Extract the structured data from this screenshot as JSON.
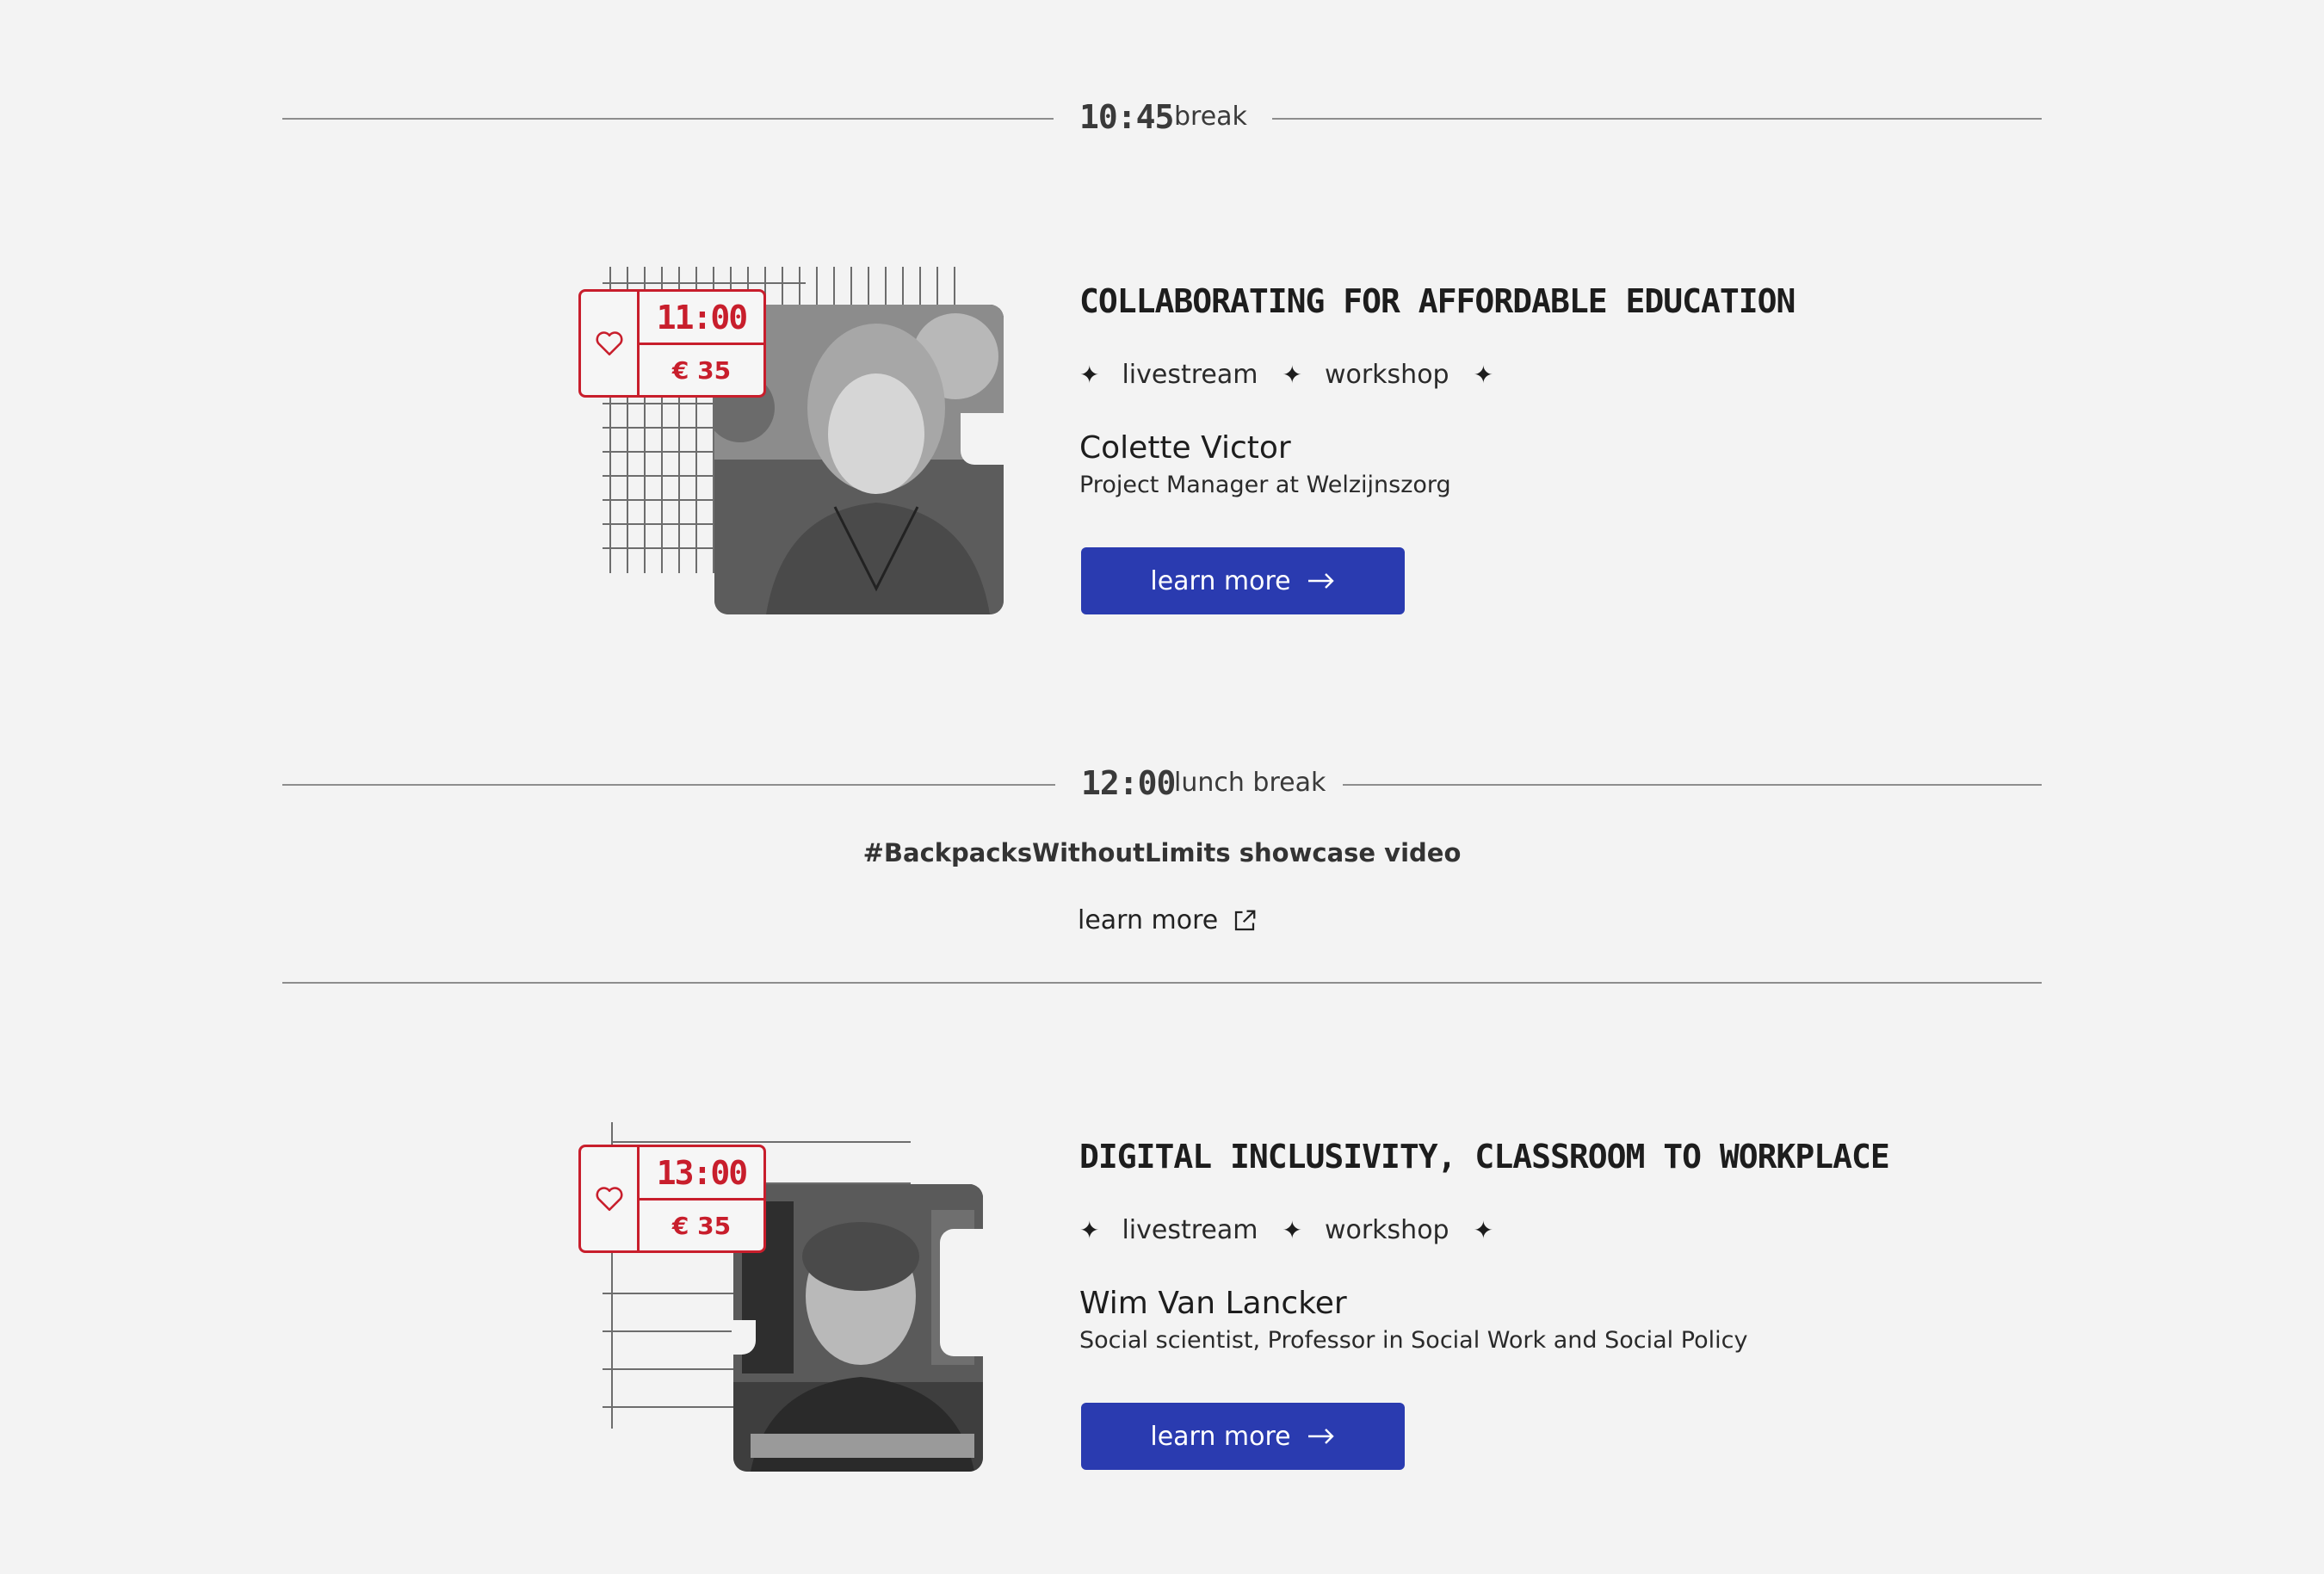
{
  "schedule": {
    "break1": {
      "time": "10:45",
      "label": "break"
    },
    "session1": {
      "time": "11:00",
      "price": "€ 35",
      "title": "COLLABORATING FOR AFFORDABLE EDUCATION",
      "tags": [
        "livestream",
        "workshop"
      ],
      "speaker": "Colette Victor",
      "role": "Project Manager at Welzijnszorg",
      "button_label": "learn more"
    },
    "break2": {
      "time": "12:00",
      "label": "lunch break"
    },
    "showcase": {
      "title": "#BackpacksWithoutLimits showcase video",
      "link_label": "learn more"
    },
    "session2": {
      "time": "13:00",
      "price": "€ 35",
      "title": "DIGITAL INCLUSIVITY, CLASSROOM TO WORKPLACE",
      "tags": [
        "livestream",
        "workshop"
      ],
      "speaker": "Wim Van Lancker",
      "role": "Social scientist, Professor in Social Work and Social Policy",
      "button_label": "learn more"
    }
  },
  "icons": {
    "heart": "heart-icon",
    "sparkle": "sparkle-icon",
    "arrow": "arrow-right-icon",
    "external": "external-link-icon"
  },
  "colors": {
    "accent_red": "#c81e2c",
    "button_blue": "#2a3bb0",
    "background": "#f3f3f3"
  }
}
